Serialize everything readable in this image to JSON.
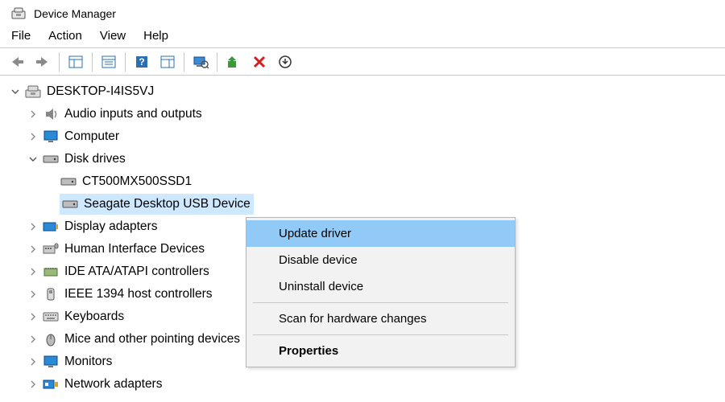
{
  "window": {
    "title": "Device Manager"
  },
  "menu": {
    "file": "File",
    "action": "Action",
    "view": "View",
    "help": "Help"
  },
  "tree": {
    "root": "DESKTOP-I4IS5VJ",
    "audio": "Audio inputs and outputs",
    "computer": "Computer",
    "disk": "Disk drives",
    "disk_child1": "CT500MX500SSD1",
    "disk_child2": "Seagate Desktop USB Device",
    "display": "Display adapters",
    "hid": "Human Interface Devices",
    "ide": "IDE ATA/ATAPI controllers",
    "ieee1394": "IEEE 1394 host controllers",
    "keyboards": "Keyboards",
    "mice": "Mice and other pointing devices",
    "monitors": "Monitors",
    "network": "Network adapters"
  },
  "context_menu": {
    "update": "Update driver",
    "disable": "Disable device",
    "uninstall": "Uninstall device",
    "scan": "Scan for hardware changes",
    "properties": "Properties"
  }
}
